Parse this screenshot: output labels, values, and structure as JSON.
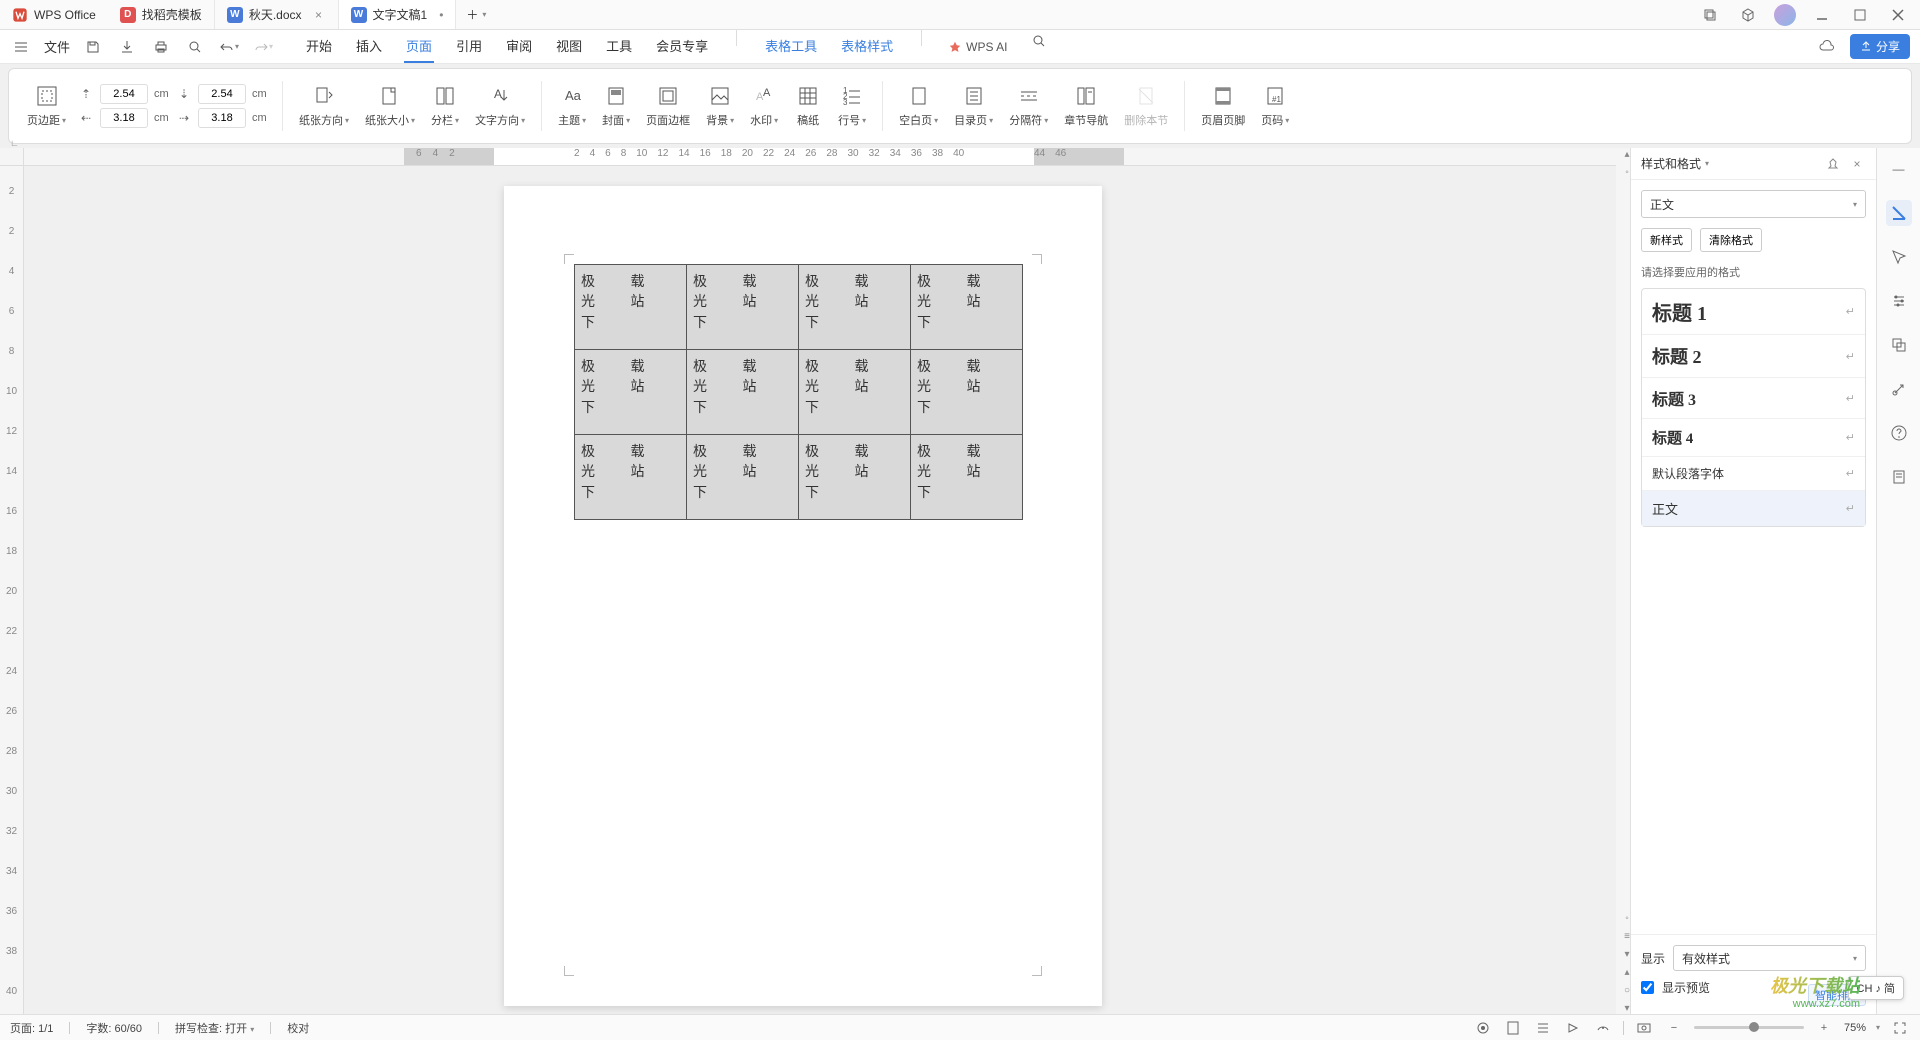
{
  "app": {
    "name": "WPS Office"
  },
  "tabs": [
    {
      "label": "找稻壳模板",
      "icon": "D",
      "iconColor": "red",
      "closeable": false
    },
    {
      "label": "秋天.docx",
      "icon": "W",
      "iconColor": "blue",
      "closeable": true
    },
    {
      "label": "文字文稿1",
      "icon": "W",
      "iconColor": "blue",
      "closeable": true,
      "dirty": true,
      "active": true
    }
  ],
  "menubar": {
    "file": "文件",
    "tabs": [
      "开始",
      "插入",
      "页面",
      "引用",
      "审阅",
      "视图",
      "工具",
      "会员专享"
    ],
    "active": "页面",
    "extra": [
      "表格工具",
      "表格样式"
    ],
    "ai": "WPS AI",
    "share": "分享"
  },
  "ribbon": {
    "margins": {
      "label": "页边距",
      "top": "2.54",
      "bottom": "2.54",
      "left": "3.18",
      "right": "3.18",
      "unit": "cm"
    },
    "items": [
      {
        "label": "纸张方向"
      },
      {
        "label": "纸张大小"
      },
      {
        "label": "分栏"
      },
      {
        "label": "文字方向"
      },
      {
        "label": "主题"
      },
      {
        "label": "封面"
      },
      {
        "label": "页面边框"
      },
      {
        "label": "背景"
      },
      {
        "label": "水印"
      },
      {
        "label": "稿纸"
      },
      {
        "label": "行号"
      },
      {
        "label": "空白页"
      },
      {
        "label": "目录页"
      },
      {
        "label": "分隔符"
      },
      {
        "label": "章节导航"
      },
      {
        "label": "删除本节"
      },
      {
        "label": "页眉页脚"
      },
      {
        "label": "页码"
      }
    ]
  },
  "ruler_h": {
    "neg": [
      "6",
      "4",
      "2"
    ],
    "mid": [
      "2",
      "4",
      "6",
      "8",
      "10",
      "12",
      "14",
      "16",
      "18",
      "20",
      "22",
      "24",
      "26",
      "28",
      "30",
      "32",
      "34",
      "36",
      "38",
      "40"
    ],
    "end": [
      "44",
      "46"
    ]
  },
  "ruler_v": [
    "2",
    "2",
    "4",
    "6",
    "8",
    "10",
    "12",
    "14",
    "16",
    "18",
    "20",
    "22",
    "24",
    "26",
    "28",
    "30",
    "32",
    "34",
    "36",
    "38",
    "40"
  ],
  "table": {
    "cell_left": "极光下",
    "cell_right": "载站"
  },
  "panel": {
    "title": "样式和格式",
    "current": "正文",
    "new": "新样式",
    "clear": "清除格式",
    "hint": "请选择要应用的格式",
    "styles": [
      {
        "label": "标题 1",
        "cls": "h1"
      },
      {
        "label": "标题 2",
        "cls": "h2"
      },
      {
        "label": "标题 3",
        "cls": "h3"
      },
      {
        "label": "标题 4",
        "cls": "h4"
      },
      {
        "label": "默认段落字体",
        "cls": "def"
      },
      {
        "label": "正文",
        "cls": "body",
        "selected": true
      }
    ],
    "show_label": "显示",
    "show_value": "有效样式",
    "preview_label": "显示预览",
    "smart": "智能排版"
  },
  "statusbar": {
    "page": "页面: 1/1",
    "words": "字数: 60/60",
    "spell": "拼写检查: 打开",
    "proof": "校对",
    "zoom": "75%"
  },
  "ime": {
    "text": "CH ♪ 简"
  },
  "watermark": {
    "line1": "极光下载站",
    "line2": "www.xz7.com"
  }
}
